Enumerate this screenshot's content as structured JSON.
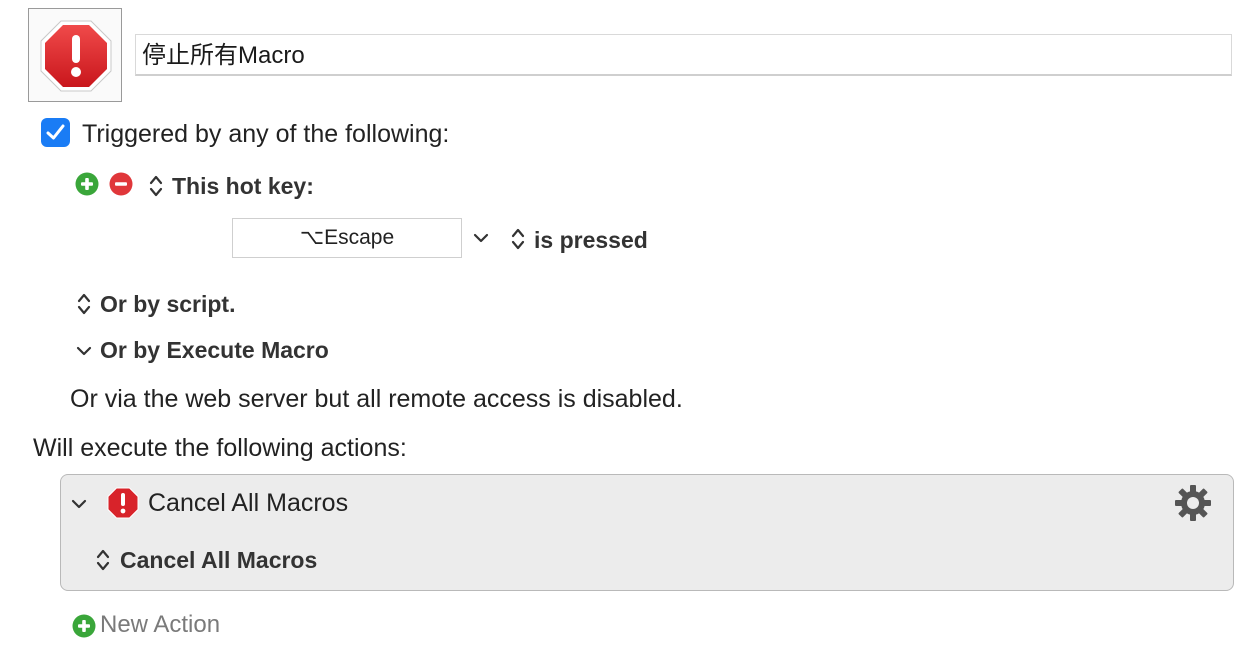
{
  "macro": {
    "name": "停止所有Macro",
    "icon": "stop-sign-icon"
  },
  "trigger": {
    "checked": true,
    "label": "Triggered by any of the following:",
    "hotkey_section_label": "This hot key:",
    "hotkey_value": "⌥Escape",
    "hotkey_condition": "is pressed",
    "script_label": "Or by script.",
    "execute_macro_label": "Or by Execute Macro",
    "web_server_text": "Or via the web server but all remote access is disabled."
  },
  "actions": {
    "header": "Will execute the following actions:",
    "items": [
      {
        "title": "Cancel All Macros",
        "option": "Cancel All Macros",
        "icon": "stop-sign-icon"
      }
    ],
    "new_action_label": "New Action"
  },
  "colors": {
    "checkbox_blue": "#1a7cf5",
    "add_green": "#3aa63a",
    "remove_red": "#e0373a",
    "stop_red": "#d8232a"
  }
}
